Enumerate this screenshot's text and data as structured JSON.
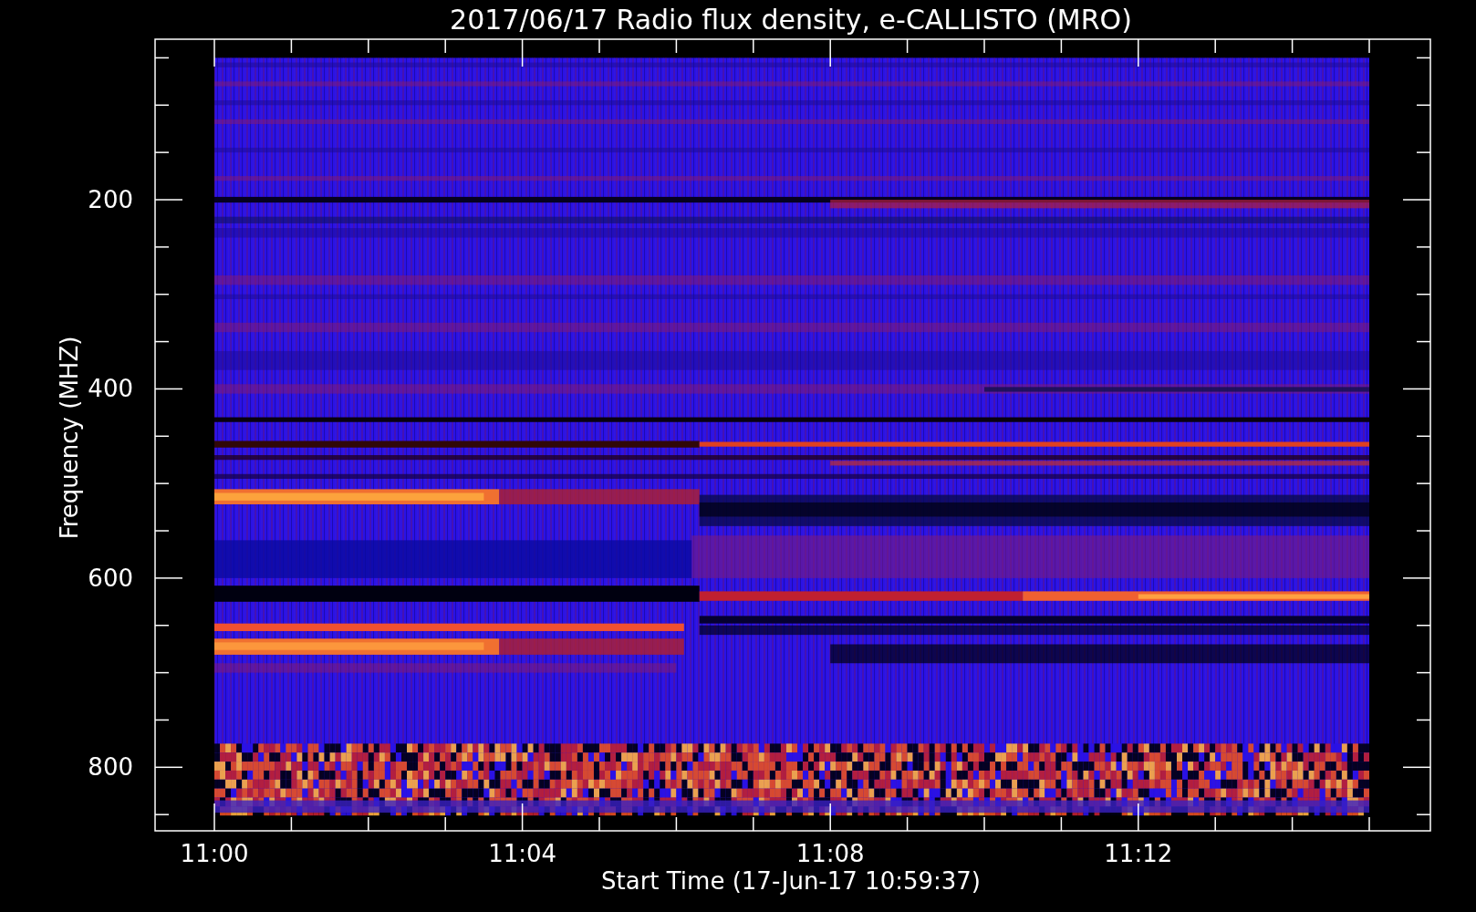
{
  "title": "2017/06/17  Radio flux density, e-CALLISTO (MRO)",
  "xlabel": "Start Time (17-Jun-17 10:59:37)",
  "ylabel": "Frequency (MHZ)",
  "x_ticks": [
    "11:00",
    "11:04",
    "11:08",
    "11:12"
  ],
  "y_ticks": [
    "200",
    "400",
    "600",
    "800"
  ]
}
